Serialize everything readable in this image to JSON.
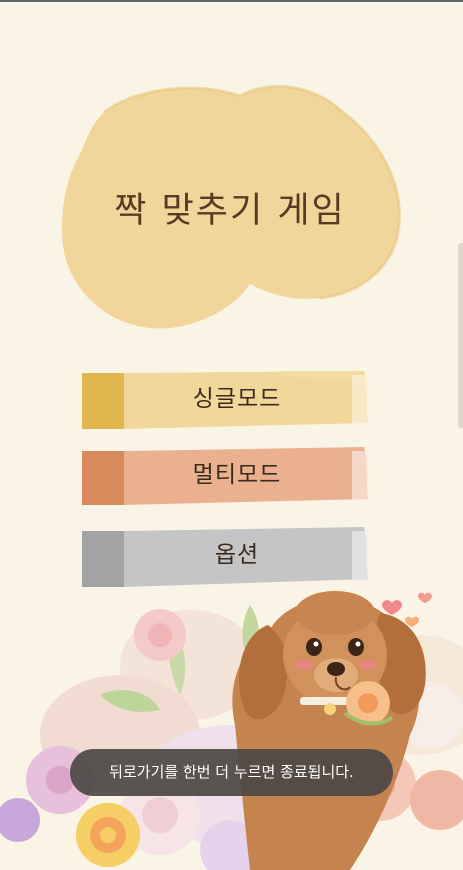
{
  "title": "짝 맞추기 게임",
  "menu": {
    "single_label": "싱글모드",
    "multi_label": "멀티모드",
    "option_label": "옵션"
  },
  "toast": {
    "message": "뒤로가기를 한번 더 누르면 종료됩니다."
  },
  "colors": {
    "background": "#faf4e6",
    "title_blob": "#f1d59b",
    "single_accent": "#e1b74d",
    "single_body": "#f1d89a",
    "multi_accent": "#d98a5c",
    "multi_body": "#eab08f",
    "option_accent": "#a3a3a3",
    "option_body": "#c5c5c5",
    "toast_bg": "#4c4844"
  },
  "illustration": {
    "subject": "poodle-with-flowers",
    "icon": "dog-illustration-icon"
  }
}
